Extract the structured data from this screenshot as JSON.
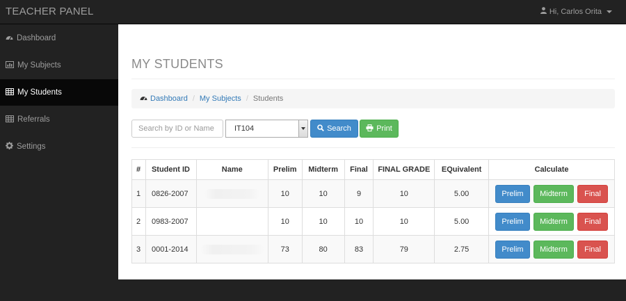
{
  "topbar": {
    "brand": "TEACHER PANEL",
    "user_greeting": "Hi, Carlos Orita",
    "user_icon": "user-icon"
  },
  "sidebar": {
    "items": [
      {
        "label": "Dashboard",
        "icon": "dashboard-icon",
        "active": false
      },
      {
        "label": "My Subjects",
        "icon": "chart-icon",
        "active": false
      },
      {
        "label": "My Students",
        "icon": "table-icon",
        "active": true
      },
      {
        "label": "Referrals",
        "icon": "table-icon",
        "active": false
      },
      {
        "label": "Settings",
        "icon": "gear-icon",
        "active": false
      }
    ]
  },
  "page": {
    "title": "MY STUDENTS"
  },
  "breadcrumb": {
    "items": [
      "Dashboard",
      "My Subjects",
      "Students"
    ]
  },
  "toolbar": {
    "search_placeholder": "Search by ID or Name",
    "search_value": "",
    "subject_selected": "IT104",
    "search_label": "Search",
    "print_label": "Print"
  },
  "table": {
    "headers": [
      "#",
      "Student ID",
      "Name",
      "Prelim",
      "Midterm",
      "Final",
      "FINAL GRADE",
      "EQuivalent",
      "Calculate"
    ],
    "rows": [
      {
        "num": "1",
        "student_id": "0826-2007",
        "name": "",
        "prelim": "10",
        "midterm": "10",
        "final": "9",
        "final_grade": "10",
        "equivalent": "5.00"
      },
      {
        "num": "2",
        "student_id": "0983-2007",
        "name": "",
        "prelim": "10",
        "midterm": "10",
        "final": "10",
        "final_grade": "10",
        "equivalent": "5.00"
      },
      {
        "num": "3",
        "student_id": "0001-2014",
        "name": "",
        "prelim": "73",
        "midterm": "80",
        "final": "83",
        "final_grade": "79",
        "equivalent": "2.75"
      }
    ],
    "calc_buttons": {
      "prelim": "Prelim",
      "midterm": "Midterm",
      "final": "Final"
    }
  },
  "colors": {
    "primary": "#428bca",
    "success": "#5cb85c",
    "danger": "#d9534f",
    "navbar": "#222222"
  }
}
